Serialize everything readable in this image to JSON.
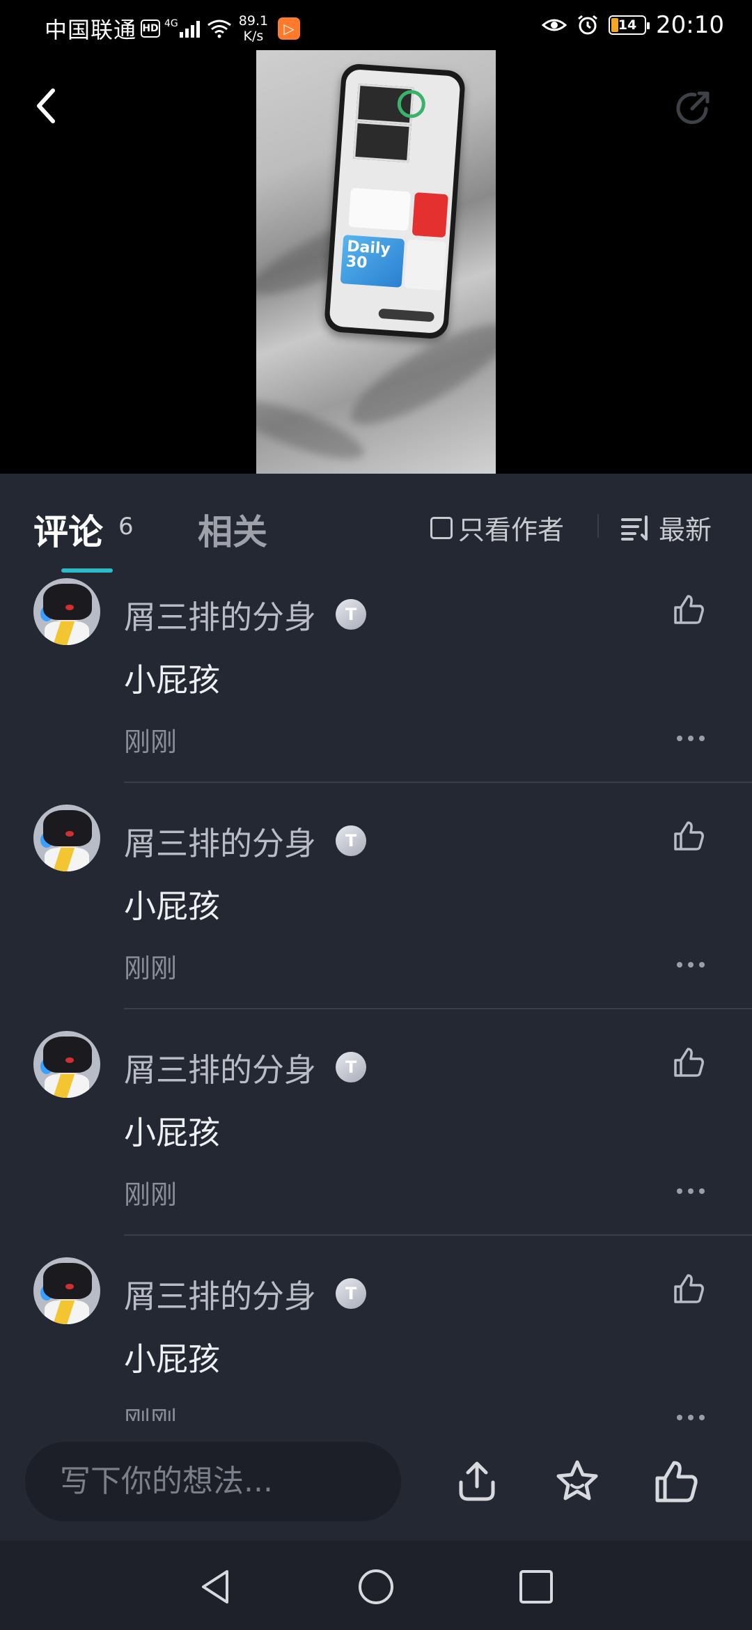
{
  "status_bar": {
    "carrier": "中国联通",
    "hd": "HD",
    "network": "4G",
    "net_speed_value": "89.1",
    "net_speed_unit": "K/s",
    "battery": "14",
    "time": "20:10"
  },
  "tabs": {
    "comments_label": "评论",
    "comments_count": "6",
    "related_label": "相关",
    "author_only_label": "只看作者",
    "sort_label": "最新"
  },
  "comments": [
    {
      "username": "屑三排的分身",
      "badge": "T",
      "text": "小屁孩",
      "time": "刚刚"
    },
    {
      "username": "屑三排的分身",
      "badge": "T",
      "text": "小屁孩",
      "time": "刚刚"
    },
    {
      "username": "屑三排的分身",
      "badge": "T",
      "text": "小屁孩",
      "time": "刚刚"
    },
    {
      "username": "屑三排的分身",
      "badge": "T",
      "text": "小屁孩",
      "time": "刚刚"
    }
  ],
  "video_preview": {
    "screen_text_1": "Daily",
    "screen_text_2": "30"
  },
  "bottom_bar": {
    "input_placeholder": "写下你的想法..."
  },
  "colors": {
    "background": "#242833",
    "accent": "#2bbcc8",
    "text_primary": "#eef0f3",
    "text_muted": "#8a8e98"
  },
  "icons": [
    "back-icon",
    "share-icon",
    "checkbox-icon",
    "sort-icon",
    "like-icon",
    "more-icon",
    "share-upload-icon",
    "favorite-star-icon",
    "nav-back-icon",
    "nav-home-icon",
    "nav-recent-icon"
  ]
}
